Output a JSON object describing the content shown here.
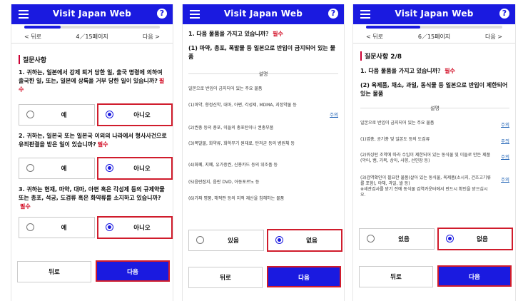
{
  "app": {
    "title": "Visit Japan Web",
    "help": "?"
  },
  "nav": {
    "back": "< 뒤로",
    "next": "다음 >"
  },
  "panel1": {
    "page": "4／15페이지",
    "progress_fraction": 0.27,
    "section_title": "질문사항",
    "questions": [
      {
        "text": "1. 귀하는, 일본에서 강제 퇴거 당한 일, 출국 명령에 의하여 출국한 일, 또는, 일본에 상륙을 거부 당한 일이 있습니까?",
        "required": "필수",
        "yes": "예",
        "no": "아니오"
      },
      {
        "text": "2. 귀하는, 일본국 또는 일본국 이외의 나라에서 형사사건으로 유죄판결을 받은 일이 있습니까?",
        "required": "필수",
        "yes": "예",
        "no": "아니오"
      },
      {
        "text": "3. 귀하는 현재, 마약, 대마, 아편 혹은 각성제 등의 규제약물 또는 총포, 석궁, 도검류 혹은 화약류를 소지하고 있습니까?",
        "required": "필수",
        "yes": "예",
        "no": "아니오"
      }
    ],
    "back_button": "뒤로",
    "next_button": "다음"
  },
  "panel2": {
    "question": "1. 다음 물품을 가지고 있습니까？",
    "required": "필수",
    "subquestion": "(1) 마약, 총포, 폭발물 등 일본으로 반입이 금지되어 있는 물품",
    "description_heading": "설명",
    "intro": "일본으로 반입이 금지되어 있는 주요 물품",
    "items": [
      "(1)마약, 향정신약, 대마, 아편, 각성제, MDMA, 지정약물 등",
      "(2)권총 등의 총포, 이들의 총포탄이나 권총부품",
      "(3)폭발물, 화약류, 화학무기 원재료, 탄저균 등의 병원체 등",
      "(4)화폐, 지폐, 유가증권, 신용카드 등의 위조품 등",
      "(5)음란잡지, 음란 DVD, 아동포르노 등",
      "(6)가짜 명품, 해적판 등의 지적 재산을 침해하는 물품"
    ],
    "note": "주의",
    "yes": "있음",
    "no": "없음",
    "back_button": "뒤로",
    "next_button": "다음"
  },
  "panel3": {
    "page": "6／15페이지",
    "progress_fraction": 0.4,
    "section_title": "질문사항 2/8",
    "question": "1. 다음 물품을 가지고 있습니까？",
    "required": "필수",
    "subquestion": "(2) 육제품, 채소, 과일, 동식물 등 일본으로 반입이 제한되어 있는 물품",
    "description_heading": "설명",
    "intro": "일본으로 반입이 금지되어 있는 주요 물품",
    "items": [
      "(1)엽총, 공기총 및 일본도 등의 도검류",
      "(2)워싱턴 조약에 따라 수입이 제한되어 있는 동식물 및 이들로 만든 제품(악어, 뱀, 거북, 상아, 사향, 선인장 등)",
      "(3)검역확인이 필요한 물품(살아 있는 동식물, 육제품(소시지, 건조고기류를 포함), 야채, 과일, 쌀 등)\n※세관검사를 받기 전에 동식물 검역카운터에서 반드시 확인을 받으십시오."
    ],
    "notes": [
      "주의",
      "주의",
      "주의",
      "주의"
    ],
    "yes": "있음",
    "no": "없음",
    "back_button": "뒤로",
    "next_button": "다음"
  },
  "colors": {
    "brand": "#1a1ae0",
    "required": "#d0021b",
    "highlight": "#d01c2c"
  }
}
